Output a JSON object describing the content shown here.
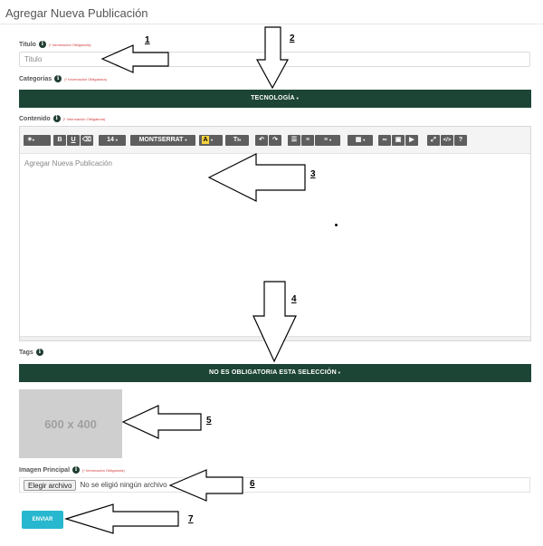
{
  "page": {
    "title": "Agregar Nueva Publicación"
  },
  "fields": {
    "titulo": {
      "label": "Titulo",
      "required_note": "(* Información Obligatoria)",
      "placeholder": "Titulo"
    },
    "categorias": {
      "label": "Categorias",
      "required_note": "(* Información Obligatoria)",
      "selected": "TECNOLOGÍA"
    },
    "contenido": {
      "label": "Contenido",
      "required_note": "(* Información Obligatoria)",
      "placeholder": "Agregar Nueva Publicación"
    },
    "tags": {
      "label": "Tags",
      "selected": "NO ES OBLIGATORIA ESTA SELECCIÓN"
    },
    "imagen": {
      "label": "Imagen Principal",
      "required_note": "(* Información Obligatoria)",
      "placeholder_image_text": "600 x 400",
      "file_button": "Elegir archivo",
      "file_status": "No se eligió ningún archivo"
    }
  },
  "toolbar": {
    "font_size": "14",
    "font_family": "MONTSERRAT",
    "groups": [
      {
        "name": "style",
        "icons": [
          "magic-wand-icon"
        ]
      },
      {
        "name": "font",
        "icons": [
          "bold-icon",
          "underline-icon",
          "eraser-icon"
        ]
      },
      {
        "name": "font-size"
      },
      {
        "name": "font-family"
      },
      {
        "name": "color",
        "icons": [
          "text-color-icon"
        ]
      },
      {
        "name": "text-height",
        "icons": [
          "text-height-icon"
        ]
      },
      {
        "name": "history",
        "icons": [
          "undo-icon",
          "redo-icon"
        ]
      },
      {
        "name": "para",
        "icons": [
          "unordered-list-icon",
          "ordered-list-icon",
          "align-icon"
        ]
      },
      {
        "name": "table",
        "icons": [
          "table-icon"
        ]
      },
      {
        "name": "insert",
        "icons": [
          "link-icon",
          "image-icon",
          "video-icon"
        ]
      },
      {
        "name": "view",
        "icons": [
          "fullscreen-icon",
          "code-view-icon",
          "help-icon"
        ]
      }
    ],
    "text_height_label": "Tı"
  },
  "submit": {
    "label": "ENVIAR"
  },
  "colors": {
    "dark_green": "#1d4536",
    "submit_cyan": "#27b8cf",
    "required_red": "#d23a3a"
  },
  "annotations": [
    "1",
    "2",
    "3",
    "4",
    "5",
    "6",
    "7"
  ]
}
